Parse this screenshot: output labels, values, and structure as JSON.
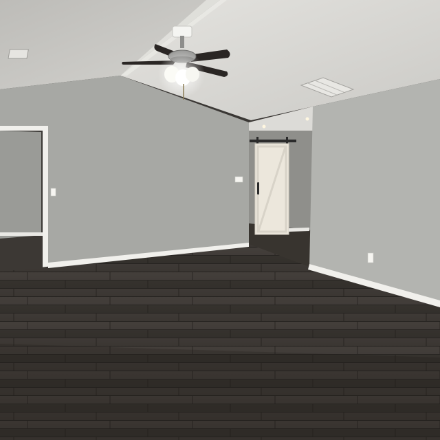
{
  "scene": {
    "description_visible_text": "",
    "colors": {
      "ceiling_left": "#c9c8c4",
      "ceiling_right": "#d8d7d3",
      "wall_left": "#a9aaa6",
      "wall_back": "#9fa09c",
      "wall_right": "#b4b5b1",
      "hall_wall": "#8f8f8b",
      "trim": "#f3f2ee",
      "floor_dark": "#2f2c29",
      "floor_mid": "#48443f",
      "floor_light": "#5c5751",
      "barn_door": "#ece7dc",
      "barn_rail": "#2b2b2b",
      "fan_blade": "#2a2624",
      "fan_metal": "#9d9d9b",
      "fan_glass": "#fbfbf6"
    }
  }
}
